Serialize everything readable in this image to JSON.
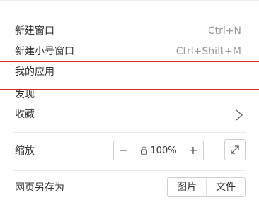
{
  "menu": {
    "new_window": {
      "label": "新建窗口",
      "shortcut": "Ctrl+N"
    },
    "new_small_window": {
      "label": "新建小号窗口",
      "shortcut": "Ctrl+Shift+M"
    },
    "my_apps": {
      "label": "我的应用"
    },
    "discover": {
      "label": "发现"
    },
    "favorites": {
      "label": "收藏"
    },
    "zoom": {
      "label": "缩放",
      "minus": "−",
      "value": "100%",
      "plus": "+"
    },
    "save_as": {
      "label": "网页另存为",
      "image": "图片",
      "file": "文件"
    }
  },
  "colors": {
    "highlight": "#d7292d",
    "text": "#333333",
    "shortcut_text": "#9a9a9a",
    "separator": "#ececec"
  },
  "icons": {
    "chevron": "chevron-right-icon",
    "lock": "lock-icon",
    "fullscreen": "fullscreen-icon"
  }
}
